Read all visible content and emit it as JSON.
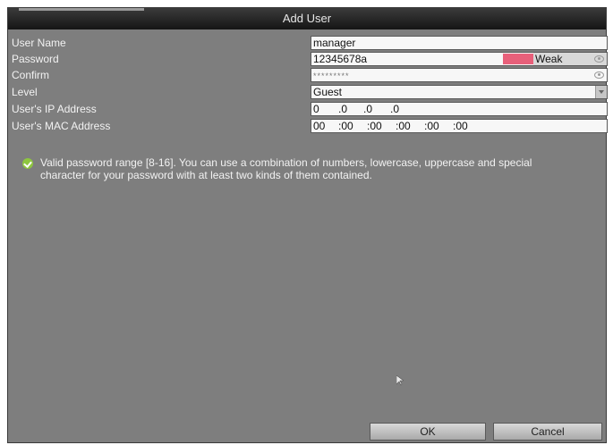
{
  "window": {
    "title": "Add User"
  },
  "form": {
    "user_name": {
      "label": "User Name",
      "value": "manager"
    },
    "password": {
      "label": "Password",
      "value": "12345678a",
      "strength": "Weak",
      "strength_color": "#e8607a"
    },
    "confirm": {
      "label": "Confirm",
      "value": "*********"
    },
    "level": {
      "label": "Level",
      "value": "Guest"
    },
    "ip": {
      "label": "User's IP Address",
      "segments": [
        "0",
        ".0",
        ".0",
        ".0"
      ]
    },
    "mac": {
      "label": "User's MAC Address",
      "segments": [
        "00",
        ":00",
        ":00",
        ":00",
        ":00",
        ":00"
      ]
    }
  },
  "hint": {
    "icon": "check-icon",
    "text": "Valid password range [8-16]. You can use a combination of numbers, lowercase, uppercase and special character for your password with at least two kinds of them contained."
  },
  "buttons": {
    "ok": "OK",
    "cancel": "Cancel"
  }
}
